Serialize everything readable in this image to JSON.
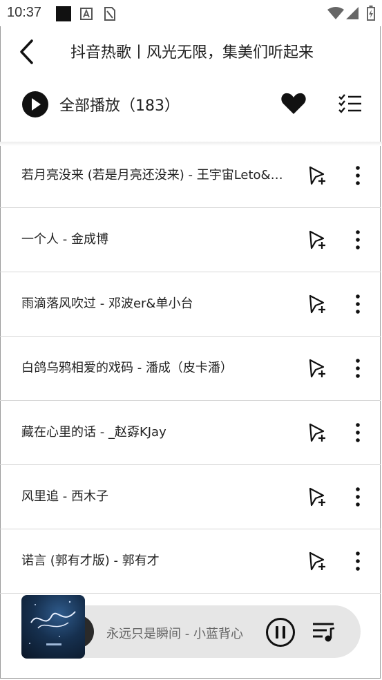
{
  "status_bar": {
    "time": "10:37",
    "icons": [
      "notification-square-icon",
      "a-badge-icon",
      "sim-card-icon",
      "wifi-icon",
      "signal-icon",
      "battery-charging-icon"
    ]
  },
  "header": {
    "back_icon": "back-arrow-icon",
    "title": "抖音热歌丨风光无限，集美们听起来"
  },
  "toolbar": {
    "play_icon": "play-circle-icon",
    "play_all_label": "全部播放（183）",
    "favorite_icon": "heart-icon",
    "multiselect_icon": "checklist-icon"
  },
  "songs": [
    {
      "title": "若月亮没来 (若是月亮还没来) - 王宇宙Leto&乔浚丞"
    },
    {
      "title": "一个人 - 金成博"
    },
    {
      "title": "雨滴落风吹过 - 邓波er&单小台"
    },
    {
      "title": "白鸽乌鸦相爱的戏码 - 潘成（皮卡潘）"
    },
    {
      "title": "藏在心里的话 - _赵孬KJay"
    },
    {
      "title": "风里追 - 西木子"
    },
    {
      "title": "诺言 (郭有才版) - 郭有才"
    }
  ],
  "song_row_icons": {
    "add": "add-to-playlist-icon",
    "more": "more-vertical-icon"
  },
  "mini_player": {
    "now_playing": "永远只是瞬间 - 小蓝背心",
    "cover_icon": "album-cover-image",
    "pause_icon": "pause-circle-icon",
    "playlist_icon": "playlist-queue-icon"
  },
  "colors": {
    "background": "#ffffff",
    "text": "#222222",
    "divider": "#d6d6d6",
    "player_bg": "#e6e6e6"
  }
}
